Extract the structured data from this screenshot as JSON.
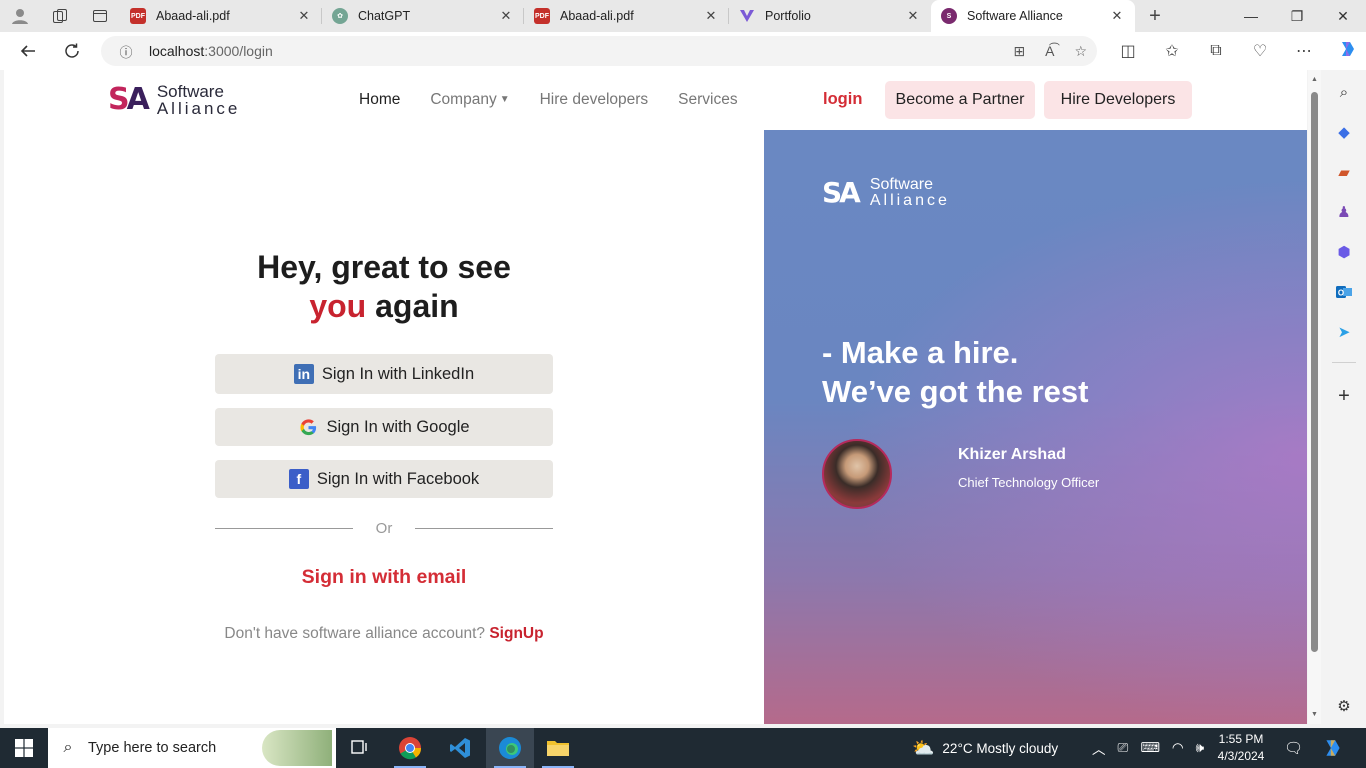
{
  "browser": {
    "tabs": [
      {
        "label": "Abaad-ali.pdf",
        "icon": "pdf-icon"
      },
      {
        "label": "ChatGPT",
        "icon": "chatgpt-icon"
      },
      {
        "label": "Abaad-ali.pdf",
        "icon": "pdf-icon"
      },
      {
        "label": "Portfolio",
        "icon": "portfolio-icon"
      },
      {
        "label": "Software Alliance",
        "icon": "software-alliance-icon",
        "active": true
      }
    ],
    "url_host": "localhost",
    "url_path": ":3000/login"
  },
  "site": {
    "logo_line1": "Software",
    "logo_line2": "Alliance",
    "logo_mark_s": "S",
    "logo_mark_a": "A",
    "nav": {
      "home": "Home",
      "company": "Company",
      "hire": "Hire developers",
      "services": "Services"
    },
    "login": "login",
    "partner_button": "Become a Partner",
    "hire_button": "Hire Developers"
  },
  "login": {
    "title_line1": "Hey, great to see",
    "title_you": "you",
    "title_again": " again",
    "linkedin": "Sign In with LinkedIn",
    "google": "Sign In with Google",
    "facebook": "Sign In with Facebook",
    "or": "Or",
    "email": "Sign in with email",
    "no_account": "Don't have software alliance account?",
    "signup": "SignUp"
  },
  "promo": {
    "logo_line1": "Software",
    "logo_line2": "Alliance",
    "tagline_line1": "- Make a hire.",
    "tagline_line2": "We’ve got the rest",
    "person_name": "Khizer Arshad",
    "person_role": "Chief Technology Officer"
  },
  "taskbar": {
    "search_placeholder": "Type here to search",
    "weather": "22°C  Mostly cloudy",
    "time": "1:55 PM",
    "date": "4/3/2024"
  },
  "colors": {
    "brand_red": "#d42d36",
    "pill_bg": "#fbe4e6",
    "sso_bg": "#e9e7e3"
  }
}
